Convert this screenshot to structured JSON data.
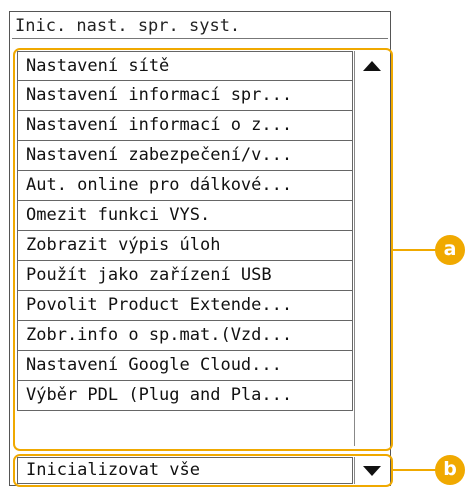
{
  "title": "Inic. nast. spr. syst.",
  "items": [
    "Nastavení sítě",
    "Nastavení informací spr...",
    "Nastavení informací o z...",
    "Nastavení zabezpečení/v...",
    "Aut. online pro dálkové...",
    "Omezit funkci VYS.",
    "Zobrazit výpis úloh",
    "Použít jako zařízení USB",
    "Povolit Product Extende...",
    "Zobr.info o sp.mat.(Vzd...",
    "Nastavení Google Cloud...",
    "Výběr PDL (Plug and Pla..."
  ],
  "bottom_item": "Inicializovat vše",
  "callouts": {
    "a": "a",
    "b": "b"
  },
  "colors": {
    "highlight": "#f0a900"
  }
}
